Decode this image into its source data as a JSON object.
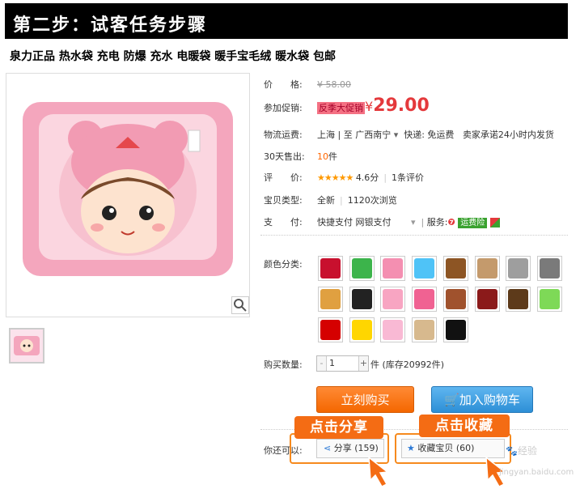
{
  "header": {
    "title": "第二步：试客任务步骤"
  },
  "product": {
    "title": "泉力正品 热水袋 充电 防爆 充水 电暖袋 暖手宝毛绒 暖水袋 包邮"
  },
  "price": {
    "label": "价　　格:",
    "currency": "¥",
    "original": "58.00"
  },
  "promo": {
    "label": "参加促销:",
    "badge": "反季大促销",
    "currency": "¥",
    "price": "29.00"
  },
  "shipping": {
    "label": "物流运费:",
    "text": "上海 | 至  广西南宁",
    "fee": "快递: 免运费",
    "promise": "卖家承诺24小时内发货"
  },
  "sales": {
    "label": "30天售出:",
    "count": "10",
    "unit": "件"
  },
  "rating": {
    "label": "评　　价:",
    "stars": "★★★★★",
    "score": "4.6分",
    "reviews": "1条评价"
  },
  "condition": {
    "label": "宝贝类型:",
    "type": "全新",
    "views": "1120次浏览"
  },
  "payment": {
    "label": "支　　付:",
    "methods": "快捷支付  网银支付",
    "service_label": "服务:",
    "insurance": "运费险"
  },
  "colors": {
    "label": "颜色分类:",
    "swatches": [
      {
        "name": "bear-red",
        "c": "#c8102e"
      },
      {
        "name": "frog-green",
        "c": "#3cb44b"
      },
      {
        "name": "pig-pink",
        "c": "#f48fb1"
      },
      {
        "name": "blue",
        "c": "#4fc3f7"
      },
      {
        "name": "bear-brown",
        "c": "#8d5524"
      },
      {
        "name": "tan",
        "c": "#c49a6c"
      },
      {
        "name": "panda",
        "c": "#9e9e9e"
      },
      {
        "name": "grey",
        "c": "#7a7a7a"
      },
      {
        "name": "orange",
        "c": "#e0a040"
      },
      {
        "name": "black",
        "c": "#222222"
      },
      {
        "name": "pink",
        "c": "#f8a5c2"
      },
      {
        "name": "pink2",
        "c": "#f06292"
      },
      {
        "name": "brown",
        "c": "#a0522d"
      },
      {
        "name": "dark-red",
        "c": "#8b1a1a"
      },
      {
        "name": "dark-brown",
        "c": "#5d3a1a"
      },
      {
        "name": "green",
        "c": "#7ed957"
      },
      {
        "name": "red",
        "c": "#d50000"
      },
      {
        "name": "yellow",
        "c": "#ffd600"
      },
      {
        "name": "light-pink",
        "c": "#f9b9d4"
      },
      {
        "name": "beige",
        "c": "#d7b98e"
      },
      {
        "name": "black2",
        "c": "#111111"
      }
    ]
  },
  "quantity": {
    "label": "购买数量:",
    "value": "1",
    "minus": "-",
    "plus": "+",
    "stock": "件 (库存20992件)"
  },
  "actions": {
    "buy": "立刻购买",
    "cart": "加入购物车"
  },
  "social": {
    "label": "你还可以:",
    "share": "分享 (159)",
    "favorite": "收藏宝贝 (60)"
  },
  "annotations": {
    "share": "点击分享",
    "favorite": "点击收藏"
  },
  "watermark": {
    "text": "经验",
    "site": "jingyan.baidu.com"
  }
}
